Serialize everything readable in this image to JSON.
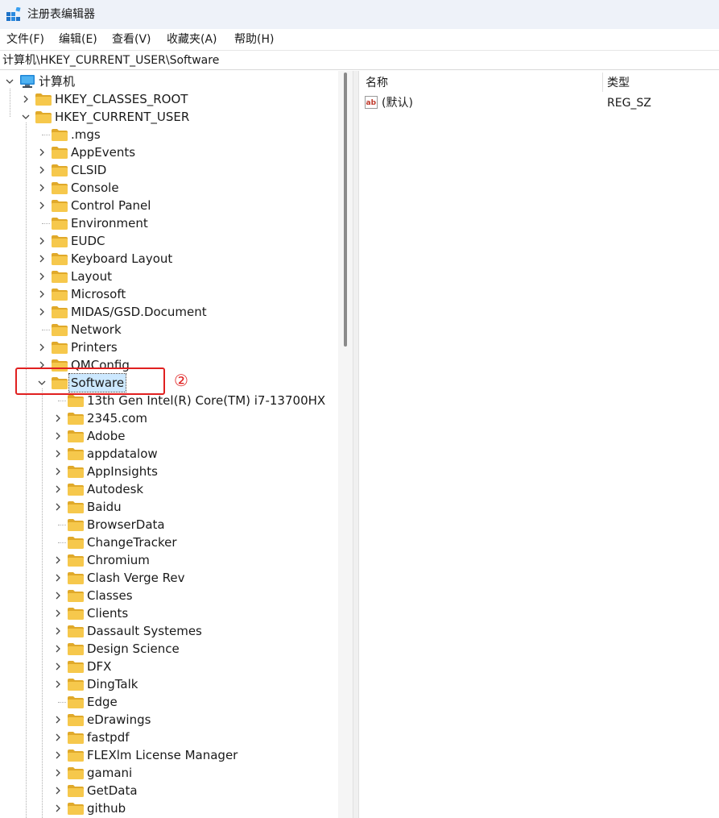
{
  "window": {
    "title": "注册表编辑器"
  },
  "menu": [
    {
      "label": "文件(F)"
    },
    {
      "label": "编辑(E)"
    },
    {
      "label": "查看(V)"
    },
    {
      "label": "收藏夹(A)"
    },
    {
      "label": "帮助(H)"
    }
  ],
  "address": {
    "path": "计算机\\HKEY_CURRENT_USER\\Software"
  },
  "tree": {
    "root": "计算机",
    "hives": [
      "HKEY_CLASSES_ROOT",
      "HKEY_CURRENT_USER"
    ],
    "hkcu_children": [
      {
        "label": ".mgs",
        "expandable": false
      },
      {
        "label": "AppEvents",
        "expandable": true
      },
      {
        "label": "CLSID",
        "expandable": true
      },
      {
        "label": "Console",
        "expandable": true
      },
      {
        "label": "Control Panel",
        "expandable": true
      },
      {
        "label": "Environment",
        "expandable": false
      },
      {
        "label": "EUDC",
        "expandable": true
      },
      {
        "label": "Keyboard Layout",
        "expandable": true
      },
      {
        "label": "Layout",
        "expandable": true
      },
      {
        "label": "Microsoft",
        "expandable": true
      },
      {
        "label": "MIDAS/GSD.Document",
        "expandable": true
      },
      {
        "label": "Network",
        "expandable": false
      },
      {
        "label": "Printers",
        "expandable": true
      },
      {
        "label": "QMConfig",
        "expandable": true
      },
      {
        "label": "Software",
        "expandable": true,
        "expanded": true,
        "selected": true
      }
    ],
    "software_children": [
      {
        "label": "13th Gen Intel(R) Core(TM) i7-13700HX",
        "expandable": false
      },
      {
        "label": "2345.com",
        "expandable": true
      },
      {
        "label": "Adobe",
        "expandable": true
      },
      {
        "label": "appdatalow",
        "expandable": true
      },
      {
        "label": "AppInsights",
        "expandable": true
      },
      {
        "label": "Autodesk",
        "expandable": true
      },
      {
        "label": "Baidu",
        "expandable": true
      },
      {
        "label": "BrowserData",
        "expandable": false
      },
      {
        "label": "ChangeTracker",
        "expandable": false
      },
      {
        "label": "Chromium",
        "expandable": true
      },
      {
        "label": "Clash Verge Rev",
        "expandable": true
      },
      {
        "label": "Classes",
        "expandable": true
      },
      {
        "label": "Clients",
        "expandable": true
      },
      {
        "label": "Dassault Systemes",
        "expandable": true
      },
      {
        "label": "Design Science",
        "expandable": true
      },
      {
        "label": "DFX",
        "expandable": true
      },
      {
        "label": "DingTalk",
        "expandable": true
      },
      {
        "label": "Edge",
        "expandable": false
      },
      {
        "label": "eDrawings",
        "expandable": true
      },
      {
        "label": "fastpdf",
        "expandable": true
      },
      {
        "label": "FLEXlm License Manager",
        "expandable": true
      },
      {
        "label": "gamani",
        "expandable": true
      },
      {
        "label": "GetData",
        "expandable": true
      },
      {
        "label": "github",
        "expandable": true
      }
    ]
  },
  "list": {
    "columns": [
      "名称",
      "类型"
    ],
    "rows": [
      {
        "name": "(默认)",
        "type": "REG_SZ"
      }
    ]
  },
  "annotation": {
    "number": "②",
    "color": "#e02020"
  },
  "colors": {
    "folder": "#f6c84c",
    "selection": "#cce8ff",
    "titlebar": "#eef2f9"
  }
}
